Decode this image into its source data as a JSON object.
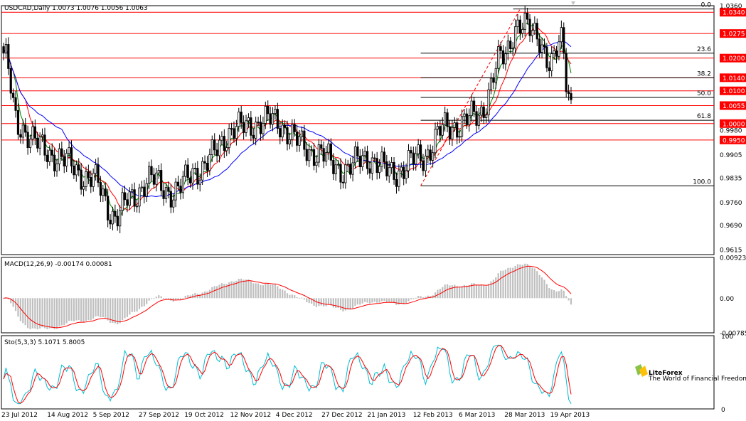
{
  "chart_data": [
    {
      "type": "candlestick",
      "header": "USDCAD,Daily  1.0073 1.0076 1.0056 1.0063",
      "ylim": [
        0.96,
        1.036
      ],
      "y_ticks": [
        "1.0360",
        "1.0275",
        "1.0200",
        "1.0140",
        "1.0100",
        "1.0055",
        "1.0000",
        "0.9980",
        "0.9905",
        "0.9835",
        "0.9760",
        "0.9690",
        "0.9615"
      ],
      "levels": [
        {
          "value": 1.034,
          "label": "1.0340",
          "color": "#ff0000",
          "tagged": true
        },
        {
          "value": 1.0275,
          "label": "1.0275",
          "color": "#ff0000",
          "tagged": true
        },
        {
          "value": 1.02,
          "label": "1.0200",
          "color": "#ff0000",
          "tagged": true
        },
        {
          "value": 1.014,
          "label": "1.0140",
          "color": "#ff0000",
          "tagged": true
        },
        {
          "value": 1.01,
          "label": "1.0100",
          "color": "#ff0000",
          "tagged": true
        },
        {
          "value": 1.0055,
          "label": "1.0055",
          "color": "#ff0000",
          "tagged": true
        },
        {
          "value": 1.0,
          "label": "1.0000",
          "color": "#ff0000",
          "tagged": true
        },
        {
          "value": 0.995,
          "label": "0.9950",
          "color": "#ff0000",
          "tagged": true
        }
      ],
      "fibonacci": [
        {
          "label": "0.0",
          "value": 1.035
        },
        {
          "label": "23.6",
          "value": 1.0215
        },
        {
          "label": "38.2",
          "value": 1.014
        },
        {
          "label": "50.0",
          "value": 1.008
        },
        {
          "label": "61.8",
          "value": 1.001
        },
        {
          "label": "100.0",
          "value": 0.981
        }
      ],
      "series": [
        {
          "name": "price",
          "color": "#000000"
        },
        {
          "name": "ma-fast",
          "color": "#008000"
        },
        {
          "name": "ma-mid",
          "color": "#ff0000"
        },
        {
          "name": "ma-slow",
          "color": "#0000ff"
        }
      ],
      "x_labels": [
        "23 Jul 2012",
        "14 Aug 2012",
        "5 Sep 2012",
        "27 Sep 2012",
        "19 Oct 2012",
        "12 Nov 2012",
        "4 Dec 2012",
        "27 Dec 2012",
        "21 Jan 2013",
        "12 Feb 2013",
        "6 Mar 2013",
        "28 Mar 2013",
        "19 Apr 2013"
      ]
    },
    {
      "type": "histogram",
      "header": "MACD(12,26,9) -0.00174 0.00081",
      "ylim": [
        -0.00785,
        0.00923
      ],
      "y_ticks": [
        "0.00923",
        "0.00",
        "-0.00785"
      ],
      "series": [
        {
          "name": "macd",
          "color": "#bfbfbf"
        },
        {
          "name": "signal",
          "color": "#ff0000"
        }
      ]
    },
    {
      "type": "line",
      "header": "Sto(5,3,3) 5.1071 5.8005",
      "ylim": [
        0,
        100
      ],
      "y_ticks": [
        "100",
        "0"
      ],
      "series": [
        {
          "name": "main",
          "color": "#00bcd4"
        },
        {
          "name": "signal",
          "color": "#ff0000"
        }
      ]
    }
  ],
  "logo": {
    "text": "LiteForex",
    "tagline": "The World of Financial Freedom"
  }
}
